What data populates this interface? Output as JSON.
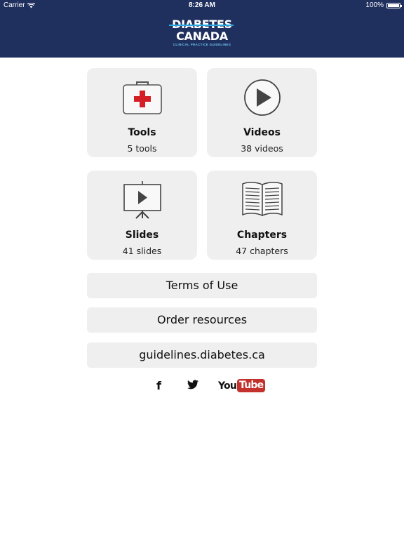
{
  "status_bar": {
    "carrier": "Carrier",
    "time": "8:26 AM",
    "battery": "100%"
  },
  "logo": {
    "line1": "DIABETES",
    "line2": "CANADA",
    "subtitle": "CLINICAL PRACTICE GUIDELINES"
  },
  "tiles": [
    {
      "label": "Tools",
      "count": "5 tools",
      "icon": "first-aid-kit-icon"
    },
    {
      "label": "Videos",
      "count": "38 videos",
      "icon": "play-circle-icon"
    },
    {
      "label": "Slides",
      "count": "41 slides",
      "icon": "presentation-easel-icon"
    },
    {
      "label": "Chapters",
      "count": "47 chapters",
      "icon": "open-book-icon"
    }
  ],
  "links": {
    "terms": "Terms of Use",
    "order": "Order resources",
    "website": "guidelines.diabetes.ca"
  },
  "social": {
    "facebook": "f",
    "youtube_you": "You",
    "youtube_tube": "Tube"
  },
  "colors": {
    "header_bg": "#1f2f5e",
    "tile_bg": "#efeff0",
    "accent_blue": "#28a8e0",
    "cross_red": "#d32027",
    "youtube_red": "#c4302b"
  }
}
